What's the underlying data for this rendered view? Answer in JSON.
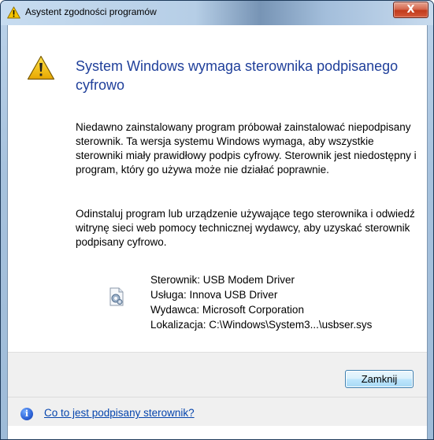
{
  "window": {
    "title": "Asystent zgodności programów",
    "close_glyph": "X"
  },
  "main": {
    "heading": "System Windows wymaga sterownika podpisanego cyfrowo",
    "paragraph1": "Niedawno zainstalowany program próbował zainstalować niepodpisany sterownik. Ta wersja systemu Windows wymaga, aby wszystkie sterowniki miały prawidłowy podpis cyfrowy. Sterownik jest niedostępny i program, który go używa może nie działać poprawnie.",
    "paragraph2": "Odinstaluj program lub urządzenie używające tego sterownika i odwiedź witrynę sieci web pomocy technicznej wydawcy, aby uzyskać sterownik podpisany cyfrowo.",
    "driver_info": {
      "driver": "Sterownik: USB Modem Driver",
      "service": "Usługa: Innova USB Driver",
      "publisher": "Wydawca: Microsoft Corporation",
      "location": "Lokalizacja: C:\\Windows\\System3...\\usbser.sys"
    }
  },
  "buttons": {
    "close_label": "Zamknij"
  },
  "footer": {
    "info_glyph": "i",
    "help_link": "Co to jest podpisany sterownik?"
  },
  "icons": {
    "title": "warning-icon",
    "main": "warning-icon",
    "driver": "driver-settings-icon",
    "footer": "info-icon"
  }
}
